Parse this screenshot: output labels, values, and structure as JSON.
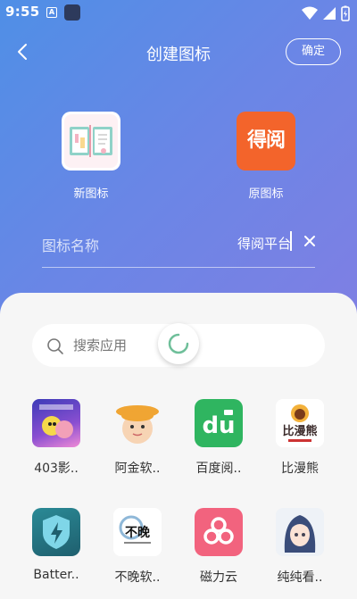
{
  "status_bar": {
    "time": "9:55",
    "a_badge": "A"
  },
  "header": {
    "title": "创建图标",
    "confirm_label": "确定"
  },
  "icons": {
    "new_label": "新图标",
    "original_label": "原图标",
    "original_text": "得阅"
  },
  "name_field": {
    "label": "图标名称",
    "value": "得阅平台"
  },
  "search": {
    "placeholder": "搜索应用"
  },
  "apps": [
    {
      "label": "403影..",
      "icon": "spongebob-movie-icon"
    },
    {
      "label": "阿金软..",
      "icon": "cartoon-hat-kid-icon"
    },
    {
      "label": "百度阅..",
      "icon": "baidu-du-icon"
    },
    {
      "label": "比漫熊",
      "icon": "bimanxiong-logo-icon"
    },
    {
      "label": "Batter..",
      "icon": "battery-shield-icon"
    },
    {
      "label": "不晚软..",
      "icon": "buwan-logo-icon"
    },
    {
      "label": "磁力云",
      "icon": "magnet-cloud-icon",
      "badge_text": ""
    },
    {
      "label": "纯纯看..",
      "icon": "anime-girl-icon"
    }
  ],
  "colors": {
    "header_gradient_start": "#4f8fe6",
    "header_gradient_end": "#7f7fe3",
    "orig_icon_bg": "#f3642b",
    "sheet_bg": "#f6f6f6"
  }
}
